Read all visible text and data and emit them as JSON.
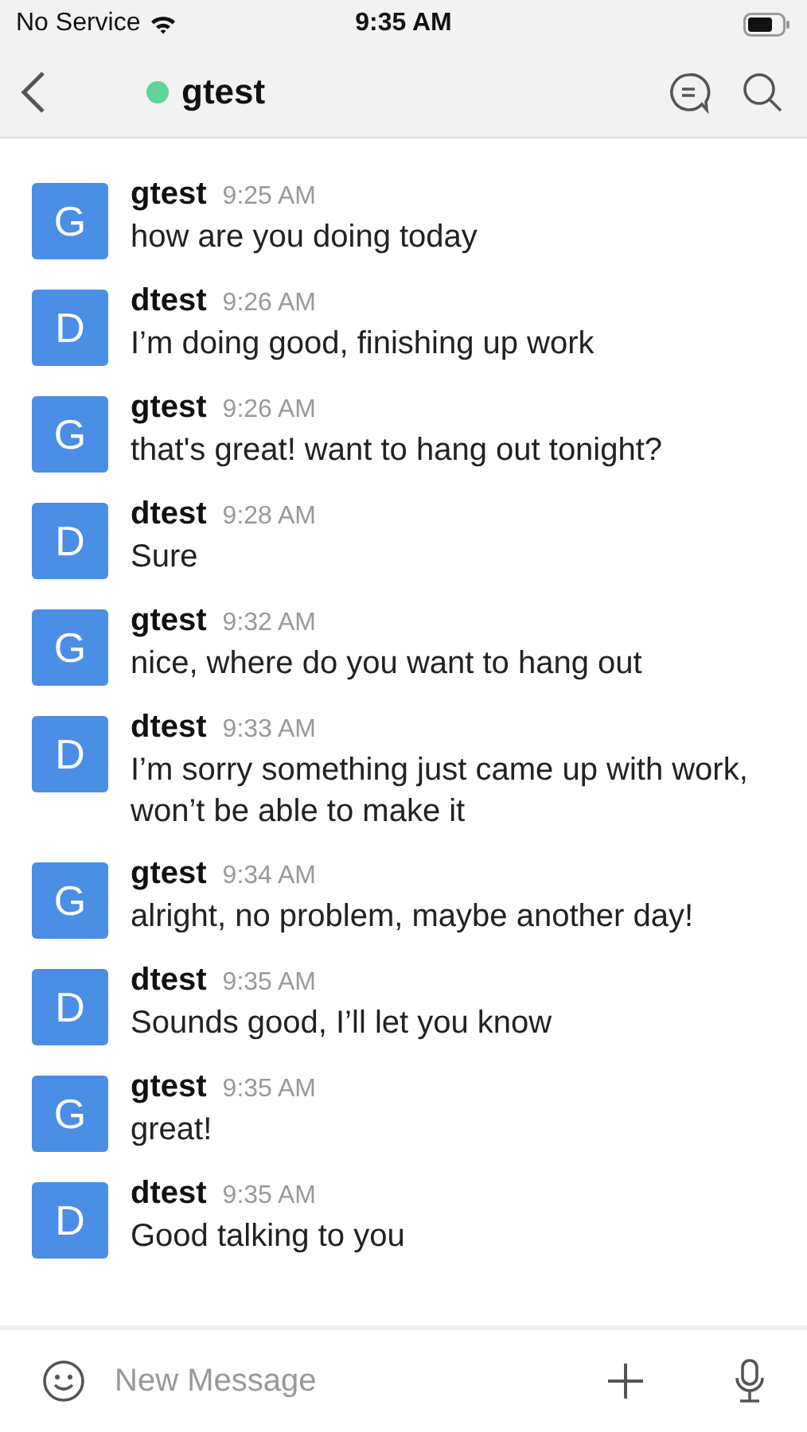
{
  "status_bar": {
    "carrier": "No Service",
    "time": "9:35 AM"
  },
  "header": {
    "title": "gtest",
    "online": true
  },
  "messages": [
    {
      "avatar": "G",
      "author": "gtest",
      "time": "9:25 AM",
      "text": "how are you doing today"
    },
    {
      "avatar": "D",
      "author": "dtest",
      "time": "9:26 AM",
      "text": "I’m doing good, finishing up work"
    },
    {
      "avatar": "G",
      "author": "gtest",
      "time": "9:26 AM",
      "text": "that's great! want to hang out tonight?"
    },
    {
      "avatar": "D",
      "author": "dtest",
      "time": "9:28 AM",
      "text": "Sure"
    },
    {
      "avatar": "G",
      "author": "gtest",
      "time": "9:32 AM",
      "text": "nice, where do you want to hang out"
    },
    {
      "avatar": "D",
      "author": "dtest",
      "time": "9:33 AM",
      "text": "I’m sorry something just came up with work, won’t be able to make it"
    },
    {
      "avatar": "G",
      "author": "gtest",
      "time": "9:34 AM",
      "text": "alright, no problem, maybe another day!"
    },
    {
      "avatar": "D",
      "author": "dtest",
      "time": "9:35 AM",
      "text": "Sounds good, I’ll let you know"
    },
    {
      "avatar": "G",
      "author": "gtest",
      "time": "9:35 AM",
      "text": "great!"
    },
    {
      "avatar": "D",
      "author": "dtest",
      "time": "9:35 AM",
      "text": "Good talking to you"
    }
  ],
  "composer": {
    "placeholder": "New Message"
  }
}
